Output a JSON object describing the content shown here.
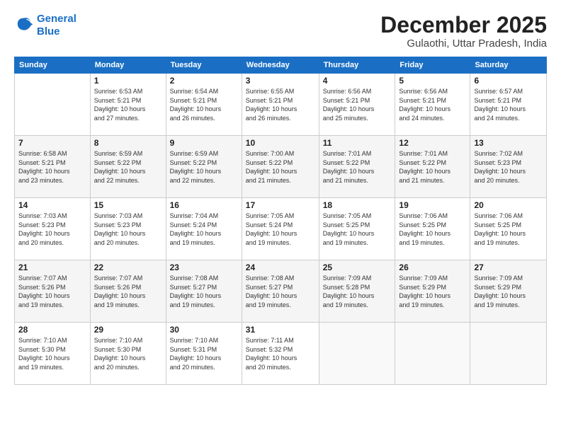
{
  "logo": {
    "line1": "General",
    "line2": "Blue"
  },
  "title": "December 2025",
  "subtitle": "Gulaothi, Uttar Pradesh, India",
  "days_of_week": [
    "Sunday",
    "Monday",
    "Tuesday",
    "Wednesday",
    "Thursday",
    "Friday",
    "Saturday"
  ],
  "weeks": [
    [
      {
        "num": "",
        "info": ""
      },
      {
        "num": "1",
        "info": "Sunrise: 6:53 AM\nSunset: 5:21 PM\nDaylight: 10 hours\nand 27 minutes."
      },
      {
        "num": "2",
        "info": "Sunrise: 6:54 AM\nSunset: 5:21 PM\nDaylight: 10 hours\nand 26 minutes."
      },
      {
        "num": "3",
        "info": "Sunrise: 6:55 AM\nSunset: 5:21 PM\nDaylight: 10 hours\nand 26 minutes."
      },
      {
        "num": "4",
        "info": "Sunrise: 6:56 AM\nSunset: 5:21 PM\nDaylight: 10 hours\nand 25 minutes."
      },
      {
        "num": "5",
        "info": "Sunrise: 6:56 AM\nSunset: 5:21 PM\nDaylight: 10 hours\nand 24 minutes."
      },
      {
        "num": "6",
        "info": "Sunrise: 6:57 AM\nSunset: 5:21 PM\nDaylight: 10 hours\nand 24 minutes."
      }
    ],
    [
      {
        "num": "7",
        "info": "Sunrise: 6:58 AM\nSunset: 5:21 PM\nDaylight: 10 hours\nand 23 minutes."
      },
      {
        "num": "8",
        "info": "Sunrise: 6:59 AM\nSunset: 5:22 PM\nDaylight: 10 hours\nand 22 minutes."
      },
      {
        "num": "9",
        "info": "Sunrise: 6:59 AM\nSunset: 5:22 PM\nDaylight: 10 hours\nand 22 minutes."
      },
      {
        "num": "10",
        "info": "Sunrise: 7:00 AM\nSunset: 5:22 PM\nDaylight: 10 hours\nand 21 minutes."
      },
      {
        "num": "11",
        "info": "Sunrise: 7:01 AM\nSunset: 5:22 PM\nDaylight: 10 hours\nand 21 minutes."
      },
      {
        "num": "12",
        "info": "Sunrise: 7:01 AM\nSunset: 5:22 PM\nDaylight: 10 hours\nand 21 minutes."
      },
      {
        "num": "13",
        "info": "Sunrise: 7:02 AM\nSunset: 5:23 PM\nDaylight: 10 hours\nand 20 minutes."
      }
    ],
    [
      {
        "num": "14",
        "info": "Sunrise: 7:03 AM\nSunset: 5:23 PM\nDaylight: 10 hours\nand 20 minutes."
      },
      {
        "num": "15",
        "info": "Sunrise: 7:03 AM\nSunset: 5:23 PM\nDaylight: 10 hours\nand 20 minutes."
      },
      {
        "num": "16",
        "info": "Sunrise: 7:04 AM\nSunset: 5:24 PM\nDaylight: 10 hours\nand 19 minutes."
      },
      {
        "num": "17",
        "info": "Sunrise: 7:05 AM\nSunset: 5:24 PM\nDaylight: 10 hours\nand 19 minutes."
      },
      {
        "num": "18",
        "info": "Sunrise: 7:05 AM\nSunset: 5:25 PM\nDaylight: 10 hours\nand 19 minutes."
      },
      {
        "num": "19",
        "info": "Sunrise: 7:06 AM\nSunset: 5:25 PM\nDaylight: 10 hours\nand 19 minutes."
      },
      {
        "num": "20",
        "info": "Sunrise: 7:06 AM\nSunset: 5:25 PM\nDaylight: 10 hours\nand 19 minutes."
      }
    ],
    [
      {
        "num": "21",
        "info": "Sunrise: 7:07 AM\nSunset: 5:26 PM\nDaylight: 10 hours\nand 19 minutes."
      },
      {
        "num": "22",
        "info": "Sunrise: 7:07 AM\nSunset: 5:26 PM\nDaylight: 10 hours\nand 19 minutes."
      },
      {
        "num": "23",
        "info": "Sunrise: 7:08 AM\nSunset: 5:27 PM\nDaylight: 10 hours\nand 19 minutes."
      },
      {
        "num": "24",
        "info": "Sunrise: 7:08 AM\nSunset: 5:27 PM\nDaylight: 10 hours\nand 19 minutes."
      },
      {
        "num": "25",
        "info": "Sunrise: 7:09 AM\nSunset: 5:28 PM\nDaylight: 10 hours\nand 19 minutes."
      },
      {
        "num": "26",
        "info": "Sunrise: 7:09 AM\nSunset: 5:29 PM\nDaylight: 10 hours\nand 19 minutes."
      },
      {
        "num": "27",
        "info": "Sunrise: 7:09 AM\nSunset: 5:29 PM\nDaylight: 10 hours\nand 19 minutes."
      }
    ],
    [
      {
        "num": "28",
        "info": "Sunrise: 7:10 AM\nSunset: 5:30 PM\nDaylight: 10 hours\nand 19 minutes."
      },
      {
        "num": "29",
        "info": "Sunrise: 7:10 AM\nSunset: 5:30 PM\nDaylight: 10 hours\nand 20 minutes."
      },
      {
        "num": "30",
        "info": "Sunrise: 7:10 AM\nSunset: 5:31 PM\nDaylight: 10 hours\nand 20 minutes."
      },
      {
        "num": "31",
        "info": "Sunrise: 7:11 AM\nSunset: 5:32 PM\nDaylight: 10 hours\nand 20 minutes."
      },
      {
        "num": "",
        "info": ""
      },
      {
        "num": "",
        "info": ""
      },
      {
        "num": "",
        "info": ""
      }
    ]
  ]
}
